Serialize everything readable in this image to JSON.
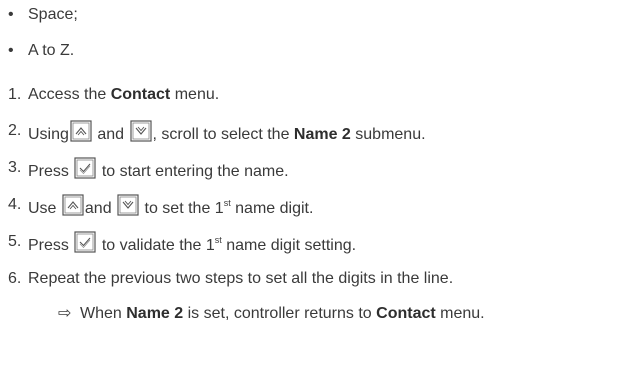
{
  "bullets": [
    {
      "text": "Space;"
    },
    {
      "text": "A to Z."
    }
  ],
  "steps": [
    {
      "num": "1.",
      "pre": "Access the ",
      "bold": "Contact",
      "post": " menu."
    },
    {
      "num": "2.",
      "pre": "Using",
      "mid": "and",
      "post1": ", scroll to select the ",
      "bold": "Name 2",
      "post2": " submenu."
    },
    {
      "num": "3.",
      "pre": "Press",
      "post": "to start entering the name."
    },
    {
      "num": "4.",
      "pre": "Use",
      "mid": "and",
      "post1": "to set the 1",
      "sup": "st",
      "post2": " name digit."
    },
    {
      "num": "5.",
      "pre": "Press",
      "post1": "to validate the 1",
      "sup": "st",
      "post2": " name digit setting."
    },
    {
      "num": "6.",
      "text": "Repeat the previous two steps to set all the digits in the line."
    }
  ],
  "result": {
    "arrow": "⇨",
    "pre": "When ",
    "bold1": "Name 2",
    "mid": " is set, controller returns to ",
    "bold2": "Contact",
    "post": " menu."
  },
  "icons": {
    "up": "up-key-icon",
    "down": "down-key-icon",
    "ok": "check-key-icon"
  },
  "colors": {
    "text": "#3a3a3a",
    "key_border": "#555555"
  }
}
